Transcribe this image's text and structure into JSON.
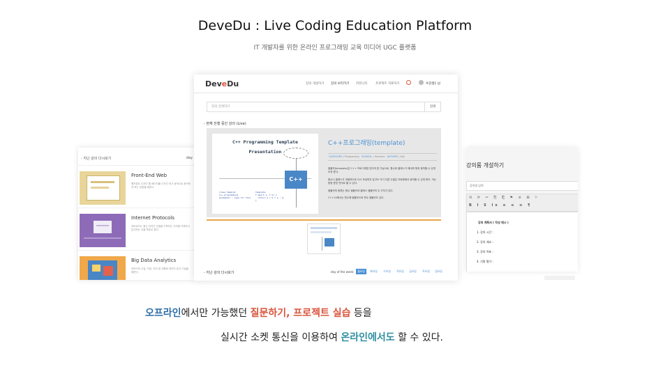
{
  "header": {
    "title": "DeveDu : Live Coding Education Platform",
    "subtitle": "IT 개발자를 위한 온라인 프로그래밍 교육 미디어 UGC 플랫폼"
  },
  "app": {
    "logo_prefix": "Dev",
    "logo_accent": "e",
    "logo_suffix": "Du",
    "nav": [
      "강의 개설하기",
      "강의 보러가기",
      "커뮤니티",
      "프로젝트 자료하기"
    ],
    "user_name": "수강생1 님",
    "search_placeholder": "강의 검색하기",
    "search_button": "검색",
    "live_section_label": "- 현재 진행 중인 강의 (Live)",
    "featured": {
      "slide_title_1": "C++ Programming Template",
      "slide_title_2": "Presentation",
      "title": "C++프로그래밍(template)",
      "meta": {
        "category_key": "CATEGORY",
        "category_val": "Programing",
        "school_key": "SCHOOL",
        "school_val": "Harvard",
        "author_key": "AUTHOR",
        "author_val": "Ally"
      },
      "paragraphs": [
        "템플릿(template)은 C++ 프로그래밍 언어의 한 기능으로, 함수와 클래스가 제네릭 형과 동작할 수 있게 도와 준다.",
        "함수나 클래스가 개별적으로 다시 작성하지 않고도 각기 다른 수많은 자료형에서 동작할 수 있게 한다. 이는 동등 문장 언어로 볼 수 있다.",
        "템플릿의 종류는 함수 템플릿과 클래스 템플릿의 두 가지가 있다.",
        "C++14에서는 변수에 템플릿으로 변수 템플릿도 있다."
      ]
    },
    "past_section_label": "- 지난 강의 다시보기",
    "day_of_week_label": "day of the week:",
    "days": [
      "월요일",
      "화요일",
      "수요일",
      "목요일",
      "금요일",
      "토요일",
      "일요일"
    ]
  },
  "left_panel": {
    "heading": "- 지난 강의 다시보기",
    "heading_right": "day",
    "items": [
      {
        "name": "Front-End Web",
        "desc": "웹프론트 디자인 웹 페이지를 디자인 하고 동적으로 동작하게 하는 방법을 배운다."
      },
      {
        "name": "Internet Protocols",
        "desc": "네트워크는 통신 장치간 연결을 구축하는 규약을 이해하고 분석하는 것을 목표로 한다."
      },
      {
        "name": "Big Data Analytics",
        "desc": "데이터의 수집, 저장, 처리 및 대용량 데이터 분석 기술을 배운다."
      }
    ]
  },
  "right_panel": {
    "title": "강의룸 개설하기",
    "input_placeholder": "강의명 입력",
    "editor_heading": "강의 계획서 ( 작성 예시 )",
    "editor_items": [
      "1. 강의 시간 :",
      "2. 강의 개요 :",
      "3. 강의 목표 :",
      "4. 기말 평가 :"
    ]
  },
  "bottom": {
    "line1_blue": "오프라인",
    "line1_mid": "에서만 가능했던 ",
    "line1_orange": "질문하기, 프로젝트 실습",
    "line1_end": " 등을",
    "line2_start": "실시간 소켓 통신을 이용하여 ",
    "line2_teal": "온라인에서도",
    "line2_end": " 할 수 있다."
  },
  "colors": {
    "accent_orange": "#d9553d",
    "accent_blue": "#2e6ea6",
    "accent_teal": "#2f8fa0",
    "link_blue": "#4a90d4"
  }
}
